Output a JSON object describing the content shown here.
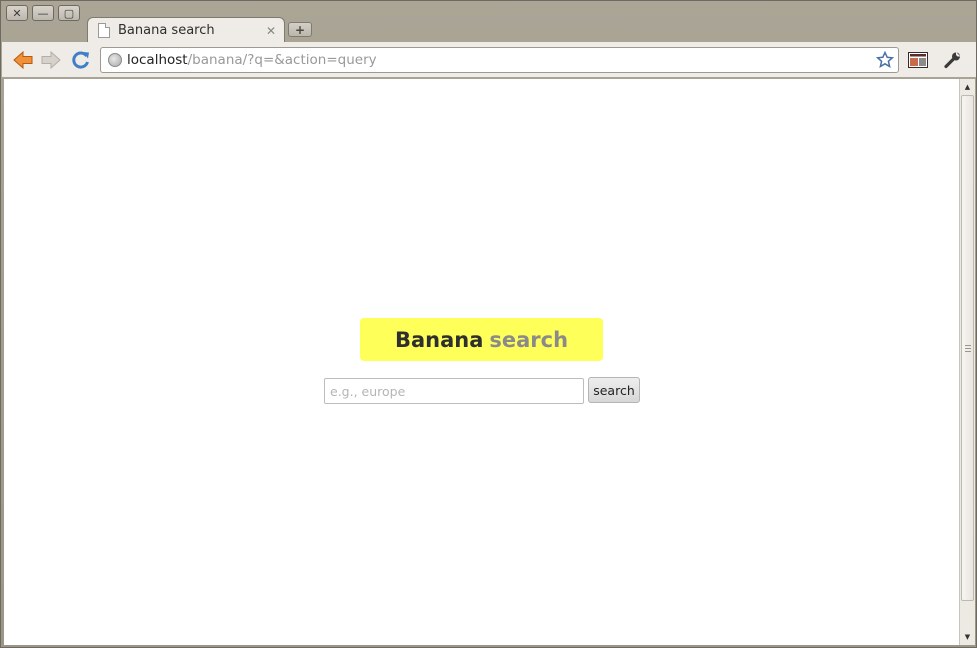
{
  "window": {
    "controls": {
      "close": "✕",
      "minimize": "—",
      "maximize": "▢"
    }
  },
  "tabs": [
    {
      "title": "Banana search",
      "close": "✕",
      "icon": "page-icon"
    }
  ],
  "new_tab": "+",
  "toolbar": {
    "url_host": "localhost",
    "url_path": "/banana/?q=&action=query",
    "icons": [
      "back-icon",
      "forward-icon",
      "reload-icon",
      "globe-icon",
      "star-icon",
      "extension-icon",
      "wrench-icon"
    ]
  },
  "page": {
    "logo_word1": "Banana",
    "logo_word2": "search",
    "search_placeholder": "e.g., europe",
    "search_value": "",
    "search_button": "search"
  },
  "colors": {
    "logo_background": "#ffff5a",
    "logo_word1": "#2f2f2f",
    "logo_word2": "#8a8a8a"
  }
}
